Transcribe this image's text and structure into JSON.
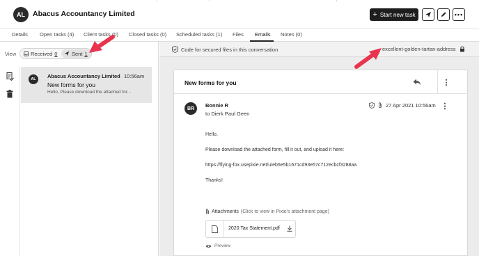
{
  "header": {
    "avatar_initials": "AL",
    "company_name": "Abacus Accountancy Limited",
    "new_task_label": "Start new task",
    "icons": [
      "send-icon",
      "edit-icon",
      "more-icon"
    ]
  },
  "tabs": [
    {
      "label": "Details"
    },
    {
      "label": "Open tasks (4)"
    },
    {
      "label": "Client tasks (0)"
    },
    {
      "label": "Closed tasks (0)"
    },
    {
      "label": "Scheduled tasks (1)"
    },
    {
      "label": "Files"
    },
    {
      "label": "Emails",
      "active": true
    },
    {
      "label": "Notes (0)"
    }
  ],
  "left": {
    "view_label": "View",
    "received_label": "Received",
    "received_count": "0",
    "sent_label": "Sent",
    "sent_count": "1",
    "message": {
      "avatar_initials": "AL",
      "from": "Abacus Accountancy Limited",
      "time": "10:56am",
      "subject": "New forms for you",
      "preview": "Hello, Please download the attached for..."
    }
  },
  "code_bar": {
    "text": "Code for secured files in this conversation",
    "code": "excellent-golden-tartan-address"
  },
  "email": {
    "subject": "New forms for you",
    "sender": "Bonnie R",
    "sender_initials": "BR",
    "recipient": "to Dierk Paul Geen",
    "date": "27 Apr 2021 10:56am",
    "body": {
      "greeting": "Hello,",
      "instructions": "Please download the attached form, fill it out, and upload it here:",
      "link": "https://flying-fox.usepixie.net/u/eb5e5b1671cd93e57c712ecbcf3288aa",
      "signoff": "Thanks!"
    },
    "attachments_label": "Attachments",
    "attachments_hint": "(Click to view in Pixie's attachment page)",
    "file_name": "2020 Tax Statement.pdf",
    "preview_label": "Preview"
  },
  "colors": {
    "accent_arrow": "#e8344e",
    "primary_button": "#1e1e1e"
  }
}
